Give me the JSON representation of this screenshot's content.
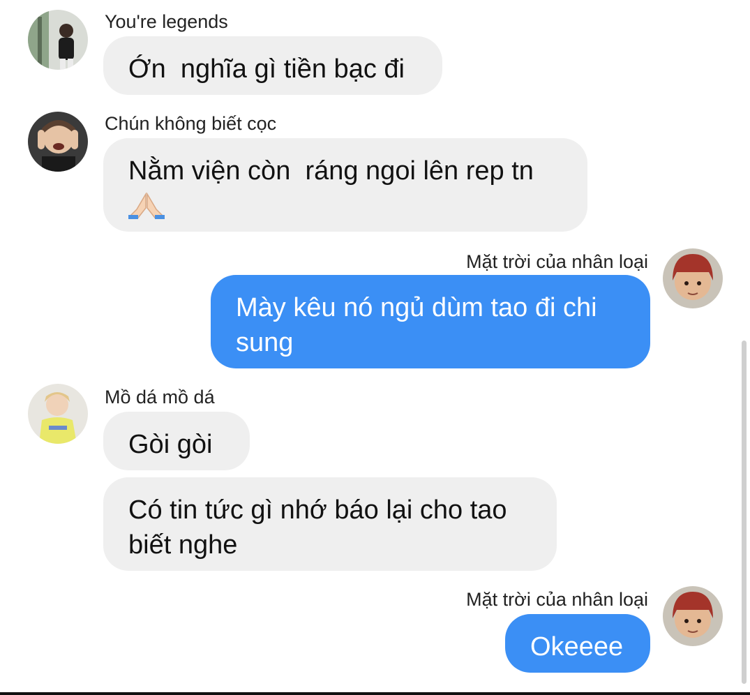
{
  "messages": [
    {
      "sender": "You're legends",
      "text": "Ớn  nghĩa gì tiền bạc đi",
      "direction": "incoming"
    },
    {
      "sender": "Chún không biết cọc",
      "text": "Nằm viện còn  ráng ngoi lên rep tn",
      "emoji": "folded-hands-emoji",
      "direction": "incoming"
    },
    {
      "sender": "Mặt trời của nhân loại",
      "text": "Mày kêu nó ngủ dùm tao đi chi sung",
      "direction": "outgoing"
    },
    {
      "sender": "Mồ dá mồ dá",
      "text": "Gòi gòi",
      "direction": "incoming"
    },
    {
      "text": "Có tin tức gì nhớ báo lại cho tao biết nghe",
      "direction": "incoming"
    },
    {
      "sender": "Mặt trời của nhân loại",
      "text": "Okeeee",
      "direction": "outgoing"
    }
  ],
  "colors": {
    "incoming_bubble": "#efefef",
    "outgoing_bubble": "#3b8ff5",
    "outgoing_text": "#ffffff"
  }
}
